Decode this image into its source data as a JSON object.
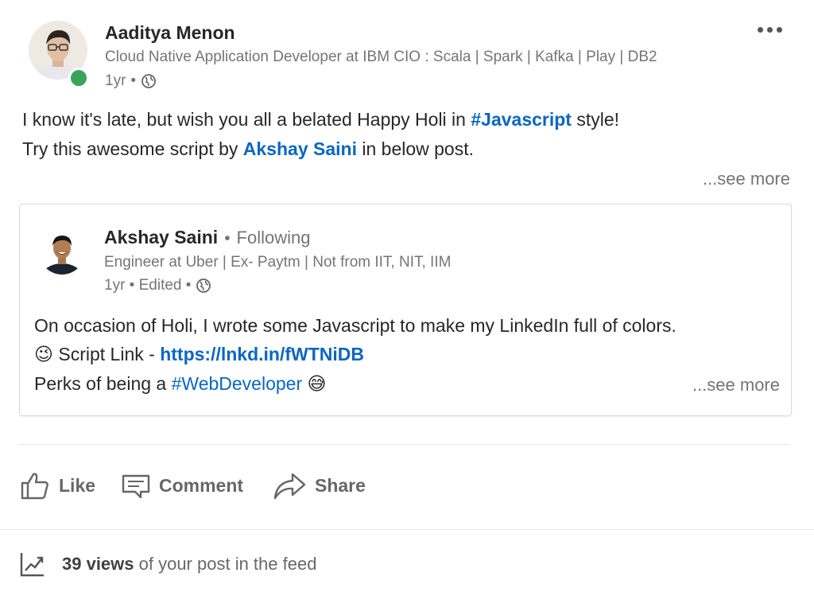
{
  "post": {
    "author": {
      "name": "Aaditya Menon",
      "headline": "Cloud Native Application Developer at IBM CIO : Scala | Spark | Kafka | Play | DB2",
      "time": "1yr",
      "separator": "•",
      "visibility_icon": "globe-icon",
      "presence": "online"
    },
    "text": {
      "line1_prefix": "I know it's late, but wish you all a belated Happy Holi in ",
      "line1_hashtag": "#Javascript",
      "line1_suffix": " style!",
      "line2_prefix": "Try this awesome script by ",
      "line2_mention": "Akshay Saini",
      "line2_suffix": " in below post."
    },
    "see_more": "...see more"
  },
  "shared": {
    "author": {
      "name": "Akshay Saini",
      "separator": "•",
      "follow_status": "Following",
      "headline": "Engineer at Uber | Ex- Paytm | Not from IIT, NIT, IIM",
      "time_edited": "1yr • Edited •",
      "visibility_icon": "globe-icon"
    },
    "text": {
      "line1": "On occasion of Holi, I wrote some Javascript to make my LinkedIn full of colors.",
      "line2_emoji": "😉",
      "line2_prefix": " Script Link - ",
      "line2_link": "https://lnkd.in/fWTNiDB",
      "line3_prefix": "Perks of being a ",
      "line3_hashtag": "#WebDeveloper",
      "line3_emoji": "😅"
    },
    "see_more": "...see more"
  },
  "actions": {
    "like": "Like",
    "comment": "Comment",
    "share": "Share"
  },
  "analytics": {
    "count": "39 views",
    "suffix": " of your post in the feed"
  },
  "colors": {
    "link": "#0a66c2",
    "presence": "#3aa35a"
  }
}
